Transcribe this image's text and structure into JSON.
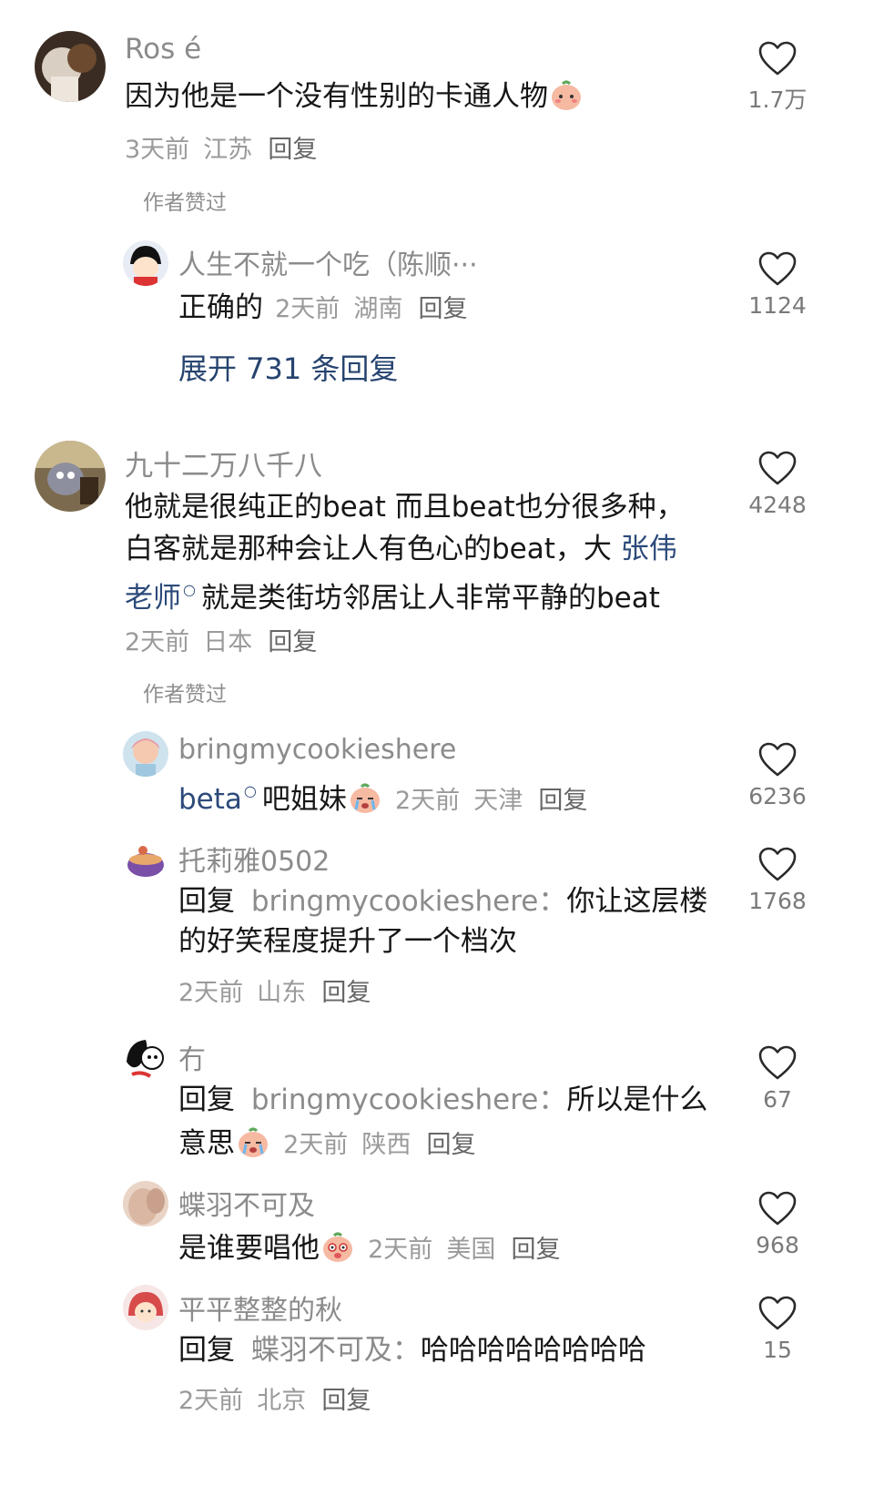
{
  "comments": [
    {
      "user": "Ros é",
      "text": "因为他是一个没有性别的卡通人物",
      "time": "3天前",
      "location": "江苏",
      "reply_label": "回复",
      "likes": "1.7万",
      "author_liked": "作者赞过"
    },
    {
      "user": "人生不就一个吃（陈顺···",
      "text": "正确的",
      "time": "2天前",
      "location": "湖南",
      "reply_label": "回复",
      "likes": "1124"
    },
    {
      "expand_label": "展开 731 条回复"
    },
    {
      "user": "九十二万八千八",
      "text_line1": "他就是很纯正的beat 而且beat也分很多种，",
      "text_line2_a": "白客就是那种会让人有色心的beat，大",
      "text_line2_link": "张伟",
      "text_line3_link": "老师",
      "text_line3_b": "就是类街坊邻居让人非常平静的beat",
      "time": "2天前",
      "location": "日本",
      "reply_label": "回复",
      "likes": "4248",
      "author_liked": "作者赞过"
    },
    {
      "user": "bringmycookieshere",
      "text_link": "beta",
      "text": "吧姐妹",
      "time": "2天前",
      "location": "天津",
      "reply_label": "回复",
      "likes": "6236"
    },
    {
      "user": "托莉雅0502",
      "reply_prefix": "回复",
      "reply_target": "bringmycookieshere：",
      "text_line1": "你让这层楼",
      "text_line2": "的好笑程度提升了一个档次",
      "time": "2天前",
      "location": "山东",
      "reply_label": "回复",
      "likes": "1768"
    },
    {
      "user": "冇",
      "reply_prefix": "回复",
      "reply_target": "bringmycookieshere：",
      "text_line1": "所以是什么",
      "text_line2": "意思",
      "time": "2天前",
      "location": "陕西",
      "reply_label": "回复",
      "likes": "67"
    },
    {
      "user": "蝶羽不可及",
      "text": "是谁要唱他",
      "time": "2天前",
      "location": "美国",
      "reply_label": "回复",
      "likes": "968"
    },
    {
      "user": "平平整整的秋",
      "reply_prefix": "回复",
      "reply_target": "蝶羽不可及：",
      "text": "哈哈哈哈哈哈哈哈",
      "time": "2天前",
      "location": "北京",
      "reply_label": "回复",
      "likes": "15"
    }
  ]
}
